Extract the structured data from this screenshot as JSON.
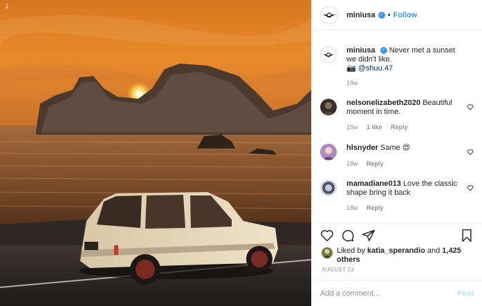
{
  "header": {
    "username": "miniusa",
    "separator": "•",
    "follow_label": "Follow"
  },
  "caption": {
    "username": "miniusa",
    "text": "Never met a sunset we didn't like.",
    "camera_emoji": "📷",
    "mention": "@shuu.47",
    "time": "18w"
  },
  "comments": [
    {
      "username": "nelsonelizabeth2020",
      "text": "Beautiful moment in time.",
      "time": "18w",
      "likes": "1 like",
      "reply": "Reply"
    },
    {
      "username": "hlsnyder",
      "text": "Same 😍",
      "time": "18w",
      "likes": "",
      "reply": "Reply"
    },
    {
      "username": "mamadiane013",
      "text": "Love the classic shape bring it back",
      "time": "18w",
      "likes": "",
      "reply": "Reply"
    }
  ],
  "likes": {
    "prefix": "Liked by",
    "liker": "katia_sperandio",
    "joiner": "and",
    "others": "1,425 others"
  },
  "date": "AUGUST 23",
  "add_comment": {
    "placeholder": "Add a comment...",
    "post_label": "Post"
  },
  "colors": {
    "link_blue": "#3897f0",
    "post_disabled": "#b2dffc",
    "muted": "#8e8e8e",
    "text": "#262626"
  }
}
